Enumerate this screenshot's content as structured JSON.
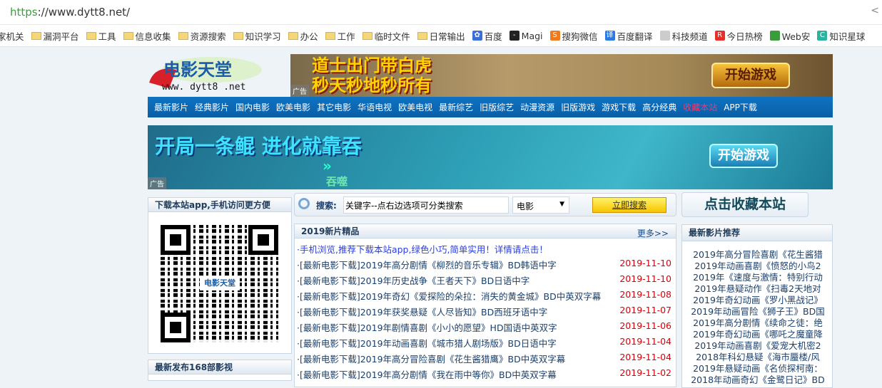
{
  "browser": {
    "url_scheme": "https",
    "url_rest": "://www.dytt8.net/",
    "bookmarks": [
      {
        "label": "家机关",
        "icon": "none"
      },
      {
        "label": "漏洞平台",
        "icon": "folder-icon"
      },
      {
        "label": "工具",
        "icon": "folder-icon"
      },
      {
        "label": "信息收集",
        "icon": "folder-icon"
      },
      {
        "label": "资源搜索",
        "icon": "folder-icon"
      },
      {
        "label": "知识学习",
        "icon": "folder-icon"
      },
      {
        "label": "办公",
        "icon": "folder-icon"
      },
      {
        "label": "工作",
        "icon": "folder-icon"
      },
      {
        "label": "临时文件",
        "icon": "folder-icon"
      },
      {
        "label": "日常输出",
        "icon": "folder-icon"
      },
      {
        "label": "百度",
        "icon": "baidu-icon"
      },
      {
        "label": "Magi",
        "icon": "magi-icon"
      },
      {
        "label": "搜狗微信",
        "icon": "sogou-icon"
      },
      {
        "label": "百度翻译",
        "icon": "translate-icon"
      },
      {
        "label": "科技频道",
        "icon": "page-icon"
      },
      {
        "label": "今日热榜",
        "icon": "r-icon"
      },
      {
        "label": "Web安",
        "icon": "web-icon"
      },
      {
        "label": "知识星球",
        "icon": "planet-icon"
      }
    ]
  },
  "logo": {
    "title": "电影天堂",
    "domain": "www. dytt8 .net"
  },
  "ad1": {
    "line1": "道士出门带白虎",
    "line2": "秒天秒地秒所有",
    "button": "开始游戏",
    "tag": "广告"
  },
  "nav": [
    "最新影片",
    "经典影片",
    "国内电影",
    "欧美电影",
    "其它电影",
    "华语电视",
    "欧美电视",
    "最新综艺",
    "旧版综艺",
    "动漫资源",
    "旧版游戏",
    "游戏下载",
    "高分经典",
    "收藏本站",
    "APP下载"
  ],
  "ad2": {
    "title": "开局一条鲲  进化就靠吞",
    "sub": "吞噬",
    "button": "开始游戏",
    "tag": "广告"
  },
  "left": {
    "app_title": "下载本站app,手机访问更方便",
    "qr_logo": "电影天堂",
    "recent_title": "最新发布168部影视"
  },
  "search": {
    "label": "搜索:",
    "value": "关键字--点右边选项可分类搜索",
    "category": "电影",
    "button": "立即搜索"
  },
  "favorite": "点击收藏本站",
  "new2019": {
    "title": "2019新片精品",
    "more": "更多>>",
    "tip": "·手机浏览,推荐下载本站app,绿色小巧,简单实用！详情请点击！",
    "items": [
      {
        "title": "·[最新电影下载]2019年高分剧情《柳烈的音乐专辑》BD韩语中字",
        "date": "2019-11-10"
      },
      {
        "title": "·[最新电影下载]2019年历史战争《王者天下》BD日语中字",
        "date": "2019-11-10"
      },
      {
        "title": "·[最新电影下载]2019年奇幻《爱探险的朵拉：消失的黄金城》BD中英双字幕",
        "date": "2019-11-08"
      },
      {
        "title": "·[最新电影下载]2019年获奖悬疑《人尽皆知》BD西班牙语中字",
        "date": "2019-11-07"
      },
      {
        "title": "·[最新电影下载]2019年剧情喜剧《小小的愿望》HD国语中英双字",
        "date": "2019-11-06"
      },
      {
        "title": "·[最新电影下载]2019年动画喜剧《城市猎人剧场版》BD日语中字",
        "date": "2019-11-04"
      },
      {
        "title": "·[最新电影下载]2019年高分冒险喜剧《花生酱猎鹰》BD中英双字幕",
        "date": "2019-11-04"
      },
      {
        "title": "·[最新电影下载]2019年高分剧情《我在雨中等你》BD中英双字幕",
        "date": "2019-11-02"
      }
    ]
  },
  "recommend": {
    "title": "最新影片推荐",
    "items": [
      "2019年高分冒险喜剧《花生酱猎",
      "2019年动画喜剧《愤怒的小鸟2",
      "2019年《速度与激情：特别行动",
      "2019年悬疑动作《扫毒2天地对",
      "2019年奇幻动画《罗小黑战记》",
      "2019年动画冒险《狮子王》BD国",
      "2019年高分剧情《续命之徒：绝",
      "2019年奇幻动画《哪吒之魔童降",
      "2019年动画喜剧《爱宠大机密2",
      "2018年科幻悬疑《海市蜃楼/风",
      "2019年悬疑动画《名侦探柯南：",
      "2018年动画奇幻《金鹭日记》BD"
    ]
  }
}
